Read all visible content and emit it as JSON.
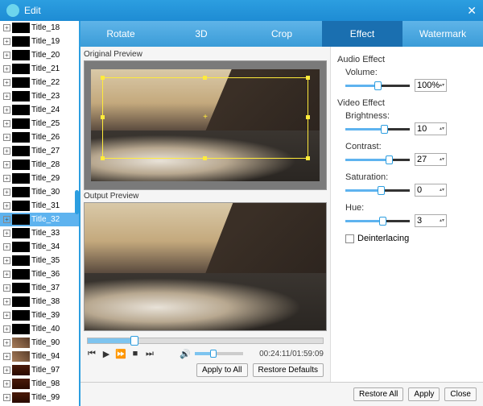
{
  "window": {
    "title": "Edit"
  },
  "sidebar": {
    "items": [
      {
        "label": "Title_18",
        "t": "b"
      },
      {
        "label": "Title_19",
        "t": "b"
      },
      {
        "label": "Title_20",
        "t": "b"
      },
      {
        "label": "Title_21",
        "t": "b"
      },
      {
        "label": "Title_22",
        "t": "b"
      },
      {
        "label": "Title_23",
        "t": "b"
      },
      {
        "label": "Title_24",
        "t": "b"
      },
      {
        "label": "Title_25",
        "t": "b"
      },
      {
        "label": "Title_26",
        "t": "b"
      },
      {
        "label": "Title_27",
        "t": "b"
      },
      {
        "label": "Title_28",
        "t": "b"
      },
      {
        "label": "Title_29",
        "t": "b"
      },
      {
        "label": "Title_30",
        "t": "b"
      },
      {
        "label": "Title_31",
        "t": "b"
      },
      {
        "label": "Title_32",
        "t": "b",
        "selected": true
      },
      {
        "label": "Title_33",
        "t": "b"
      },
      {
        "label": "Title_34",
        "t": "b"
      },
      {
        "label": "Title_35",
        "t": "b"
      },
      {
        "label": "Title_36",
        "t": "b"
      },
      {
        "label": "Title_37",
        "t": "b"
      },
      {
        "label": "Title_38",
        "t": "b"
      },
      {
        "label": "Title_39",
        "t": "b"
      },
      {
        "label": "Title_40",
        "t": "b"
      },
      {
        "label": "Title_90",
        "t": "i"
      },
      {
        "label": "Title_94",
        "t": "i"
      },
      {
        "label": "Title_97",
        "t": "r"
      },
      {
        "label": "Title_98",
        "t": "r"
      },
      {
        "label": "Title_99",
        "t": "r"
      }
    ]
  },
  "tabs": {
    "rotate": "Rotate",
    "threed": "3D",
    "crop": "Crop",
    "effect": "Effect",
    "watermark": "Watermark",
    "active": "effect"
  },
  "preview": {
    "original": "Original Preview",
    "output": "Output Preview"
  },
  "playback": {
    "time": "00:24:11/01:59:09",
    "apply_all": "Apply to All",
    "restore": "Restore Defaults"
  },
  "effects": {
    "audio_title": "Audio Effect",
    "volume": {
      "label": "Volume:",
      "value": "100%",
      "pct": 45
    },
    "video_title": "Video Effect",
    "brightness": {
      "label": "Brightness:",
      "value": "10",
      "pct": 55
    },
    "contrast": {
      "label": "Contrast:",
      "value": "27",
      "pct": 62
    },
    "saturation": {
      "label": "Saturation:",
      "value": "0",
      "pct": 50
    },
    "hue": {
      "label": "Hue:",
      "value": "3",
      "pct": 52
    },
    "deinterlace": "Deinterlacing"
  },
  "footer": {
    "restore_all": "Restore All",
    "apply": "Apply",
    "close": "Close"
  }
}
